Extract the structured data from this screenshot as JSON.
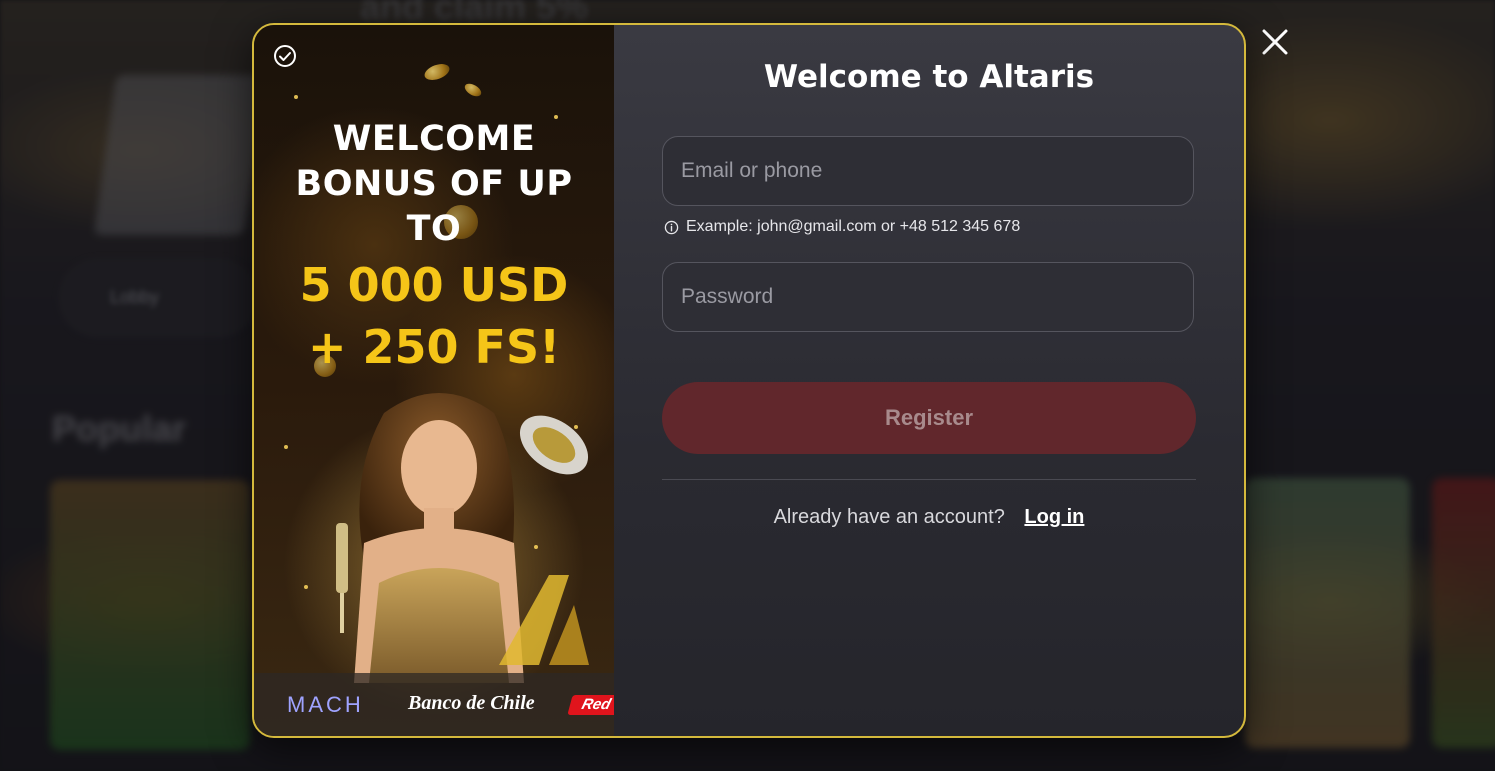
{
  "background": {
    "top_text": "and claim 5%",
    "lobby_label": "Lobby",
    "section_title": "Popular"
  },
  "promo": {
    "headline": "WELCOME BONUS OF UP TO",
    "amount": "5 000 USD + 250 FS!",
    "payments": {
      "mach": "MACH",
      "banco": "Banco de Chile",
      "red": "Red"
    }
  },
  "form": {
    "title": "Welcome to Altaris",
    "email_placeholder": "Email or phone",
    "email_value": "",
    "hint": "Example: john@gmail.com or +48 512 345 678",
    "password_placeholder": "Password",
    "password_value": "",
    "register_label": "Register",
    "login_prompt": "Already have an account?",
    "login_link": "Log in"
  },
  "colors": {
    "modal_border": "#d4b93c",
    "accent_gold": "#f5c518",
    "register_bg": "#61272c",
    "modal_bg": "#2e2e35"
  },
  "icons": {
    "close": "close-icon",
    "check": "check-circle-icon",
    "info": "info-icon"
  }
}
